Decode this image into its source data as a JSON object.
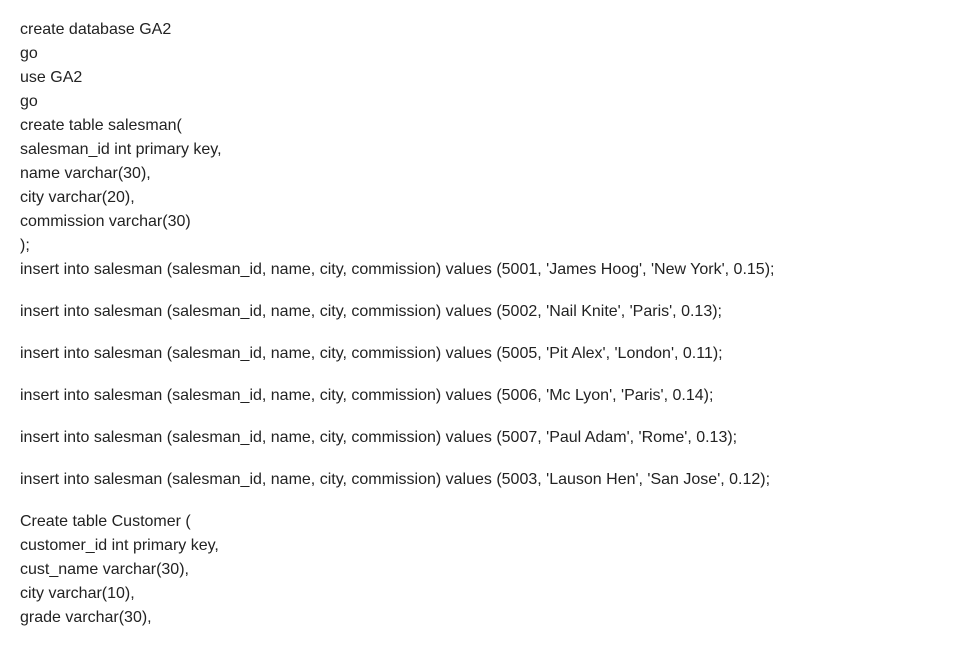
{
  "lines": [
    "create database GA2",
    "go",
    "use GA2",
    "go",
    "create table salesman(",
    "salesman_id int primary key,",
    "name varchar(30),",
    "city varchar(20),",
    "commission varchar(30)",
    ");",
    "insert into salesman (salesman_id, name, city, commission) values (5001, 'James Hoog', 'New York', 0.15);",
    "",
    "insert into salesman (salesman_id, name, city, commission) values (5002, 'Nail Knite', 'Paris', 0.13);",
    "",
    "insert into salesman (salesman_id, name, city, commission) values (5005, 'Pit Alex', 'London', 0.11);",
    "",
    "insert into salesman (salesman_id, name, city, commission) values (5006, 'Mc Lyon', 'Paris', 0.14);",
    "",
    "insert into salesman (salesman_id, name, city, commission) values (5007, 'Paul Adam', 'Rome', 0.13);",
    "",
    "insert into salesman (salesman_id, name, city, commission) values (5003, 'Lauson Hen', 'San Jose', 0.12);",
    "",
    "Create table Customer (",
    "customer_id int primary key,",
    "cust_name varchar(30),",
    "city varchar(10),",
    "grade varchar(30),"
  ]
}
